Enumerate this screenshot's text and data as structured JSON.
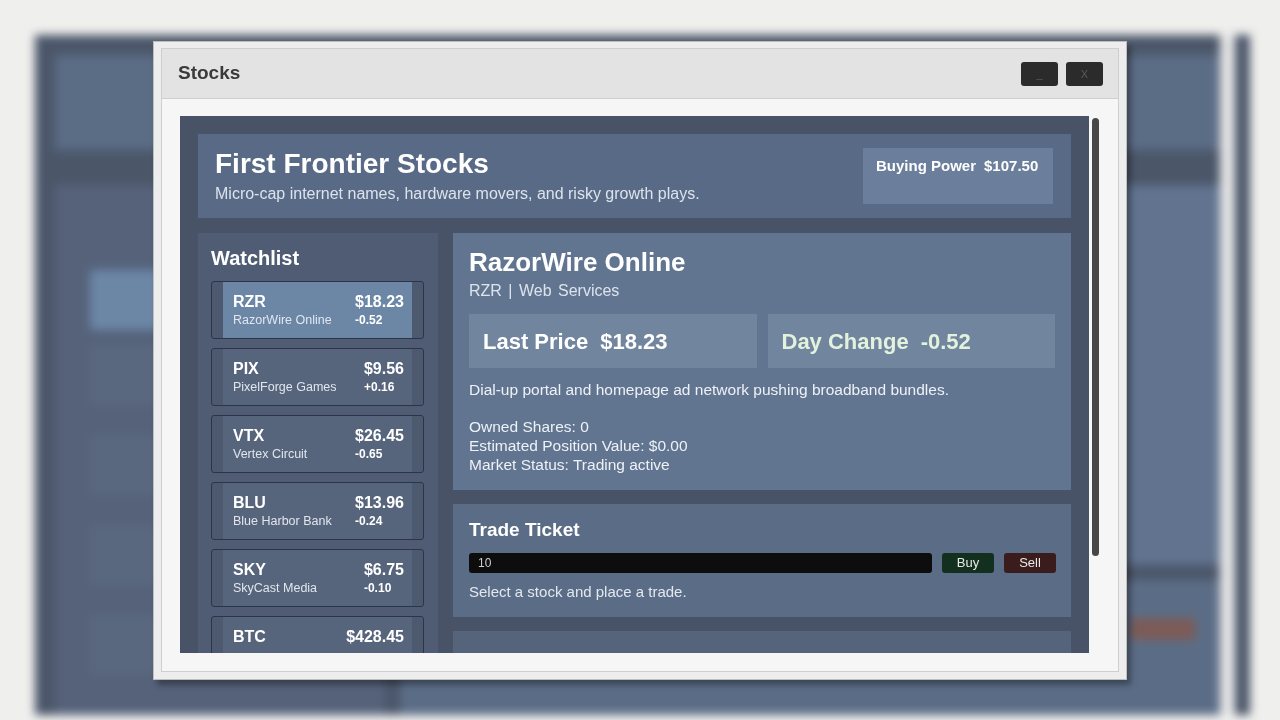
{
  "window": {
    "title": "Stocks",
    "controls": [
      "_",
      "X"
    ]
  },
  "header": {
    "title": "First Frontier Stocks",
    "subtitle": "Micro-cap internet names, hardware movers, and risky growth plays.",
    "buying_power": {
      "label": "Buying Power",
      "value": "$107.50"
    }
  },
  "watchlist": {
    "title": "Watchlist",
    "items": [
      {
        "ticker": "RZR",
        "name": "RazorWire Online",
        "price": "$18.23",
        "change": "-0.52",
        "selected": true
      },
      {
        "ticker": "PIX",
        "name": "PixelForge Games",
        "price": "$9.56",
        "change": "+0.16",
        "selected": false
      },
      {
        "ticker": "VTX",
        "name": "Vertex Circuit",
        "price": "$26.45",
        "change": "-0.65",
        "selected": false
      },
      {
        "ticker": "BLU",
        "name": "Blue Harbor Bank",
        "price": "$13.96",
        "change": "-0.24",
        "selected": false
      },
      {
        "ticker": "SKY",
        "name": "SkyCast Media",
        "price": "$6.75",
        "change": "-0.10",
        "selected": false
      },
      {
        "ticker": "BTC",
        "price": "$428.45",
        "selected": false
      }
    ]
  },
  "detail": {
    "title": "RazorWire Online",
    "subtitle": "RZR | Web Services",
    "stats": [
      {
        "kind": "price",
        "label": "Last Price",
        "value": "$18.23"
      },
      {
        "kind": "change",
        "label": "Day Change",
        "value": "-0.52"
      }
    ],
    "description": "Dial-up portal and homepage ad network pushing broadband bundles.",
    "facts": [
      "Owned Shares: 0",
      "Estimated Position Value: $0.00",
      "Market Status: Trading active"
    ]
  },
  "trade_ticket": {
    "title": "Trade Ticket",
    "quantity": "10",
    "buttons": [
      {
        "kind": "buy",
        "label": "Buy"
      },
      {
        "kind": "sell",
        "label": "Sell"
      }
    ],
    "message": "Select a stock and place a trade."
  }
}
